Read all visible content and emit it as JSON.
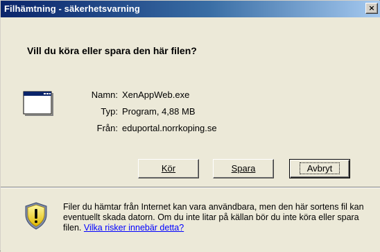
{
  "window": {
    "title": "Filhämtning - säkerhetsvarning",
    "close_label": "×"
  },
  "question": "Vill du köra eller spara den här filen?",
  "details": [
    {
      "label": "Namn:",
      "value": "XenAppWeb.exe"
    },
    {
      "label": "Typ:",
      "value": "Program, 4,88 MB"
    },
    {
      "label": "Från:",
      "value": "eduportal.norrkoping.se"
    }
  ],
  "buttons": {
    "run": "Kör",
    "save": "Spara",
    "cancel": "Avbryt"
  },
  "warning": {
    "text": "Filer du hämtar från Internet kan vara användbara, men den här sortens fil kan eventuellt skada datorn. Om du inte litar på källan bör du inte köra eller spara filen.",
    "link": "Vilka risker innebär detta?"
  },
  "icons": {
    "file": "application-window-icon",
    "warning": "security-shield-icon"
  },
  "colors": {
    "title_start": "#0a246a",
    "title_end": "#a6caf0",
    "link": "#0000ff"
  }
}
